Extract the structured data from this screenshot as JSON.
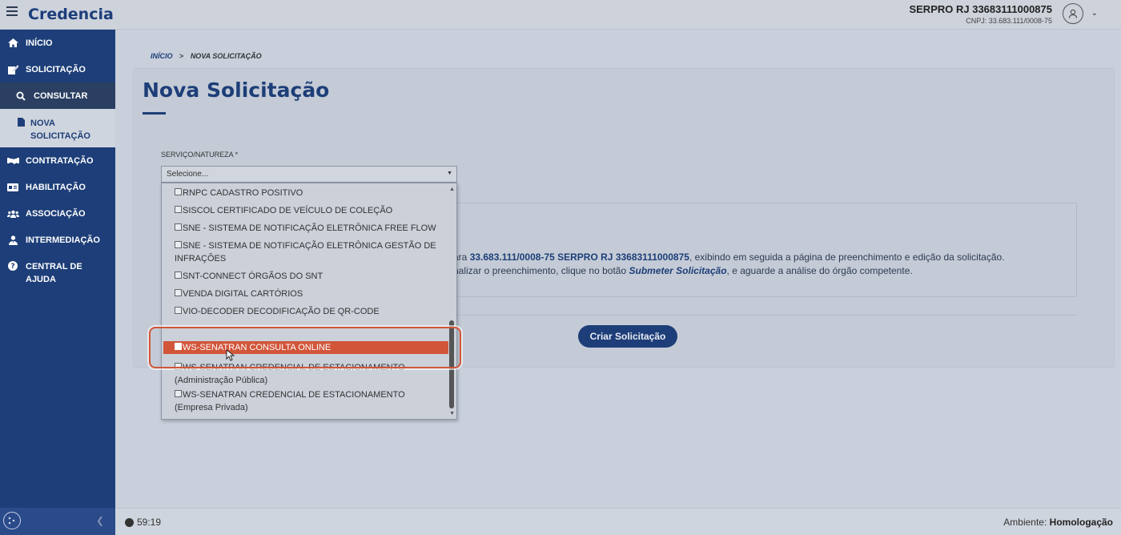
{
  "app": {
    "brand": "Credencia",
    "org_name": "SERPRO RJ 33683111000875",
    "org_cnpj": "CNPJ: 33.683.111/0008-75"
  },
  "sidebar": {
    "items": [
      {
        "label": "INÍCIO",
        "icon": "home-icon"
      },
      {
        "label": "SOLICITAÇÃO",
        "icon": "edit-icon"
      },
      {
        "label": "CONSULTAR",
        "icon": "search-icon"
      },
      {
        "label": "NOVA SOLICITAÇÃO",
        "icon": "file-icon"
      },
      {
        "label": "CONTRATAÇÃO",
        "icon": "handshake-icon"
      },
      {
        "label": "HABILITAÇÃO",
        "icon": "id-card-icon"
      },
      {
        "label": "ASSOCIAÇÃO",
        "icon": "users-icon"
      },
      {
        "label": "INTERMEDIAÇÃO",
        "icon": "user-tie-icon"
      },
      {
        "label": "CENTRAL DE AJUDA",
        "icon": "question-icon"
      }
    ]
  },
  "breadcrumb": {
    "home": "INÍCIO",
    "separator": ">",
    "current": "NOVA SOLICITAÇÃO"
  },
  "page": {
    "title": "Nova Solicitação"
  },
  "form": {
    "service_label": "SERVIÇO/NATUREZA *",
    "select_value": "Selecione...",
    "options": [
      "RNPC CADASTRO POSITIVO",
      "SISCOL CERTIFICADO DE VEÍCULO DE COLEÇÃO",
      "SNE - SISTEMA DE NOTIFICAÇÃO ELETRÔNICA FREE FLOW",
      "SNE - SISTEMA DE NOTIFICAÇÃO ELETRÔNICA GESTÃO DE INFRAÇÕES",
      "SNT-CONNECT ÓRGÃOS DO SNT",
      "VENDA DIGITAL CARTÓRIOS",
      "VIO-DECODER DECODIFICAÇÃO DE QR-CODE",
      "WS-SENATRAN CONSULTA ONLINE",
      "WS-SENATRAN CREDENCIAL DE ESTACIONAMENTO (Administração Pública)",
      "WS-SENATRAN CREDENCIAL DE ESTACIONAMENTO (Empresa Privada)"
    ],
    "highlighted_option": "WS-SENATRAN CONSULTA ONLINE"
  },
  "info": {
    "line1_prefix": "ara",
    "line1_bold": "33.683.111/0008-75 SERPRO RJ 33683111000875",
    "line1_suffix": ", exibindo em seguida a página de preenchimento e edição da solicitação.",
    "line2_prefix": "nalizar o preenchimento, clique no botão",
    "line2_bold": "Submeter Solicitação",
    "line2_suffix": ", e aguarde a análise do órgão competente."
  },
  "actions": {
    "create_label": "Criar Solicitação"
  },
  "footer": {
    "timer": "59:19",
    "env_label": "Ambiente:",
    "env_value": "Homologação"
  },
  "colors": {
    "brand": "#1d3e78",
    "highlight": "#d2553a"
  }
}
